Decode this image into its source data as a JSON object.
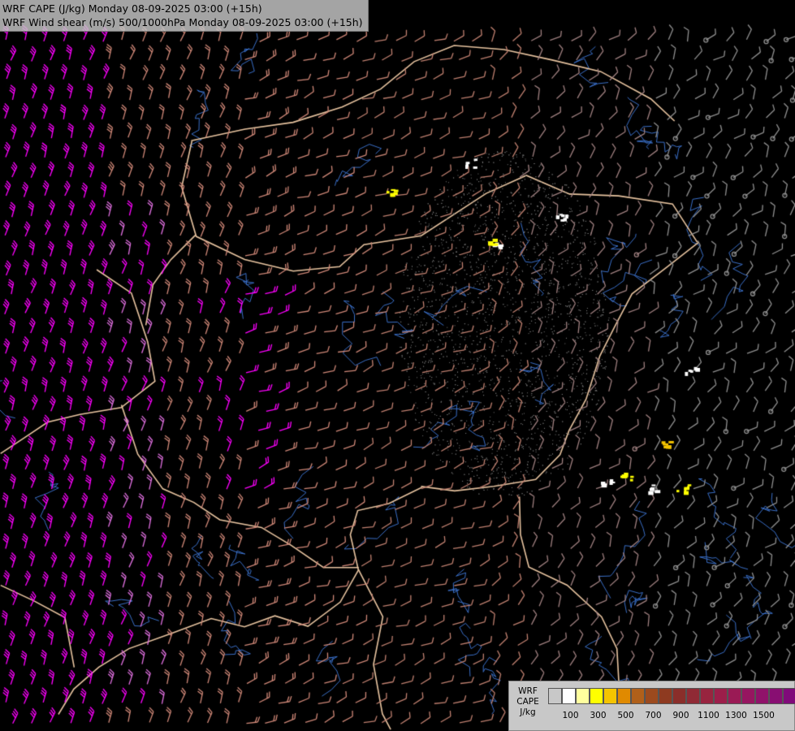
{
  "header": {
    "line1": "WRF CAPE (J/kg) Monday 08-09-2025 03:00 (+15h)",
    "line2": "WRF Wind shear (m/s) 500/1000hPa Monday 08-09-2025 03:00 (+15h)"
  },
  "legend": {
    "label_lines": [
      "WRF",
      "CAPE",
      "J/kg"
    ],
    "colors": [
      "#c8c8c8",
      "#ffffff",
      "#ffff9e",
      "#ffff00",
      "#f5c400",
      "#e08a00",
      "#b0601a",
      "#9c4a1e",
      "#8e3a20",
      "#8a2e2a",
      "#902a35",
      "#98243f",
      "#9c1e4a",
      "#9a1a55",
      "#961660",
      "#90126a",
      "#880e72",
      "#800a7a"
    ],
    "ticks": [
      {
        "label": "100",
        "index": 1
      },
      {
        "label": "300",
        "index": 3
      },
      {
        "label": "500",
        "index": 5
      },
      {
        "label": "700",
        "index": 7
      },
      {
        "label": "900",
        "index": 9
      },
      {
        "label": "1100",
        "index": 11
      },
      {
        "label": "1300",
        "index": 13
      },
      {
        "label": "1500",
        "index": 15
      }
    ]
  },
  "map_style": {
    "background": "#000000",
    "border_color": "#e8c4a0",
    "river_color": "#3a6fc8",
    "barb_colors": [
      "#ff00ff",
      "#e070e0",
      "#d08878",
      "#c08070",
      "#a08080",
      "#909090"
    ],
    "cape_colors": [
      "#ffffff",
      "#ffff00",
      "#f5c400"
    ]
  }
}
